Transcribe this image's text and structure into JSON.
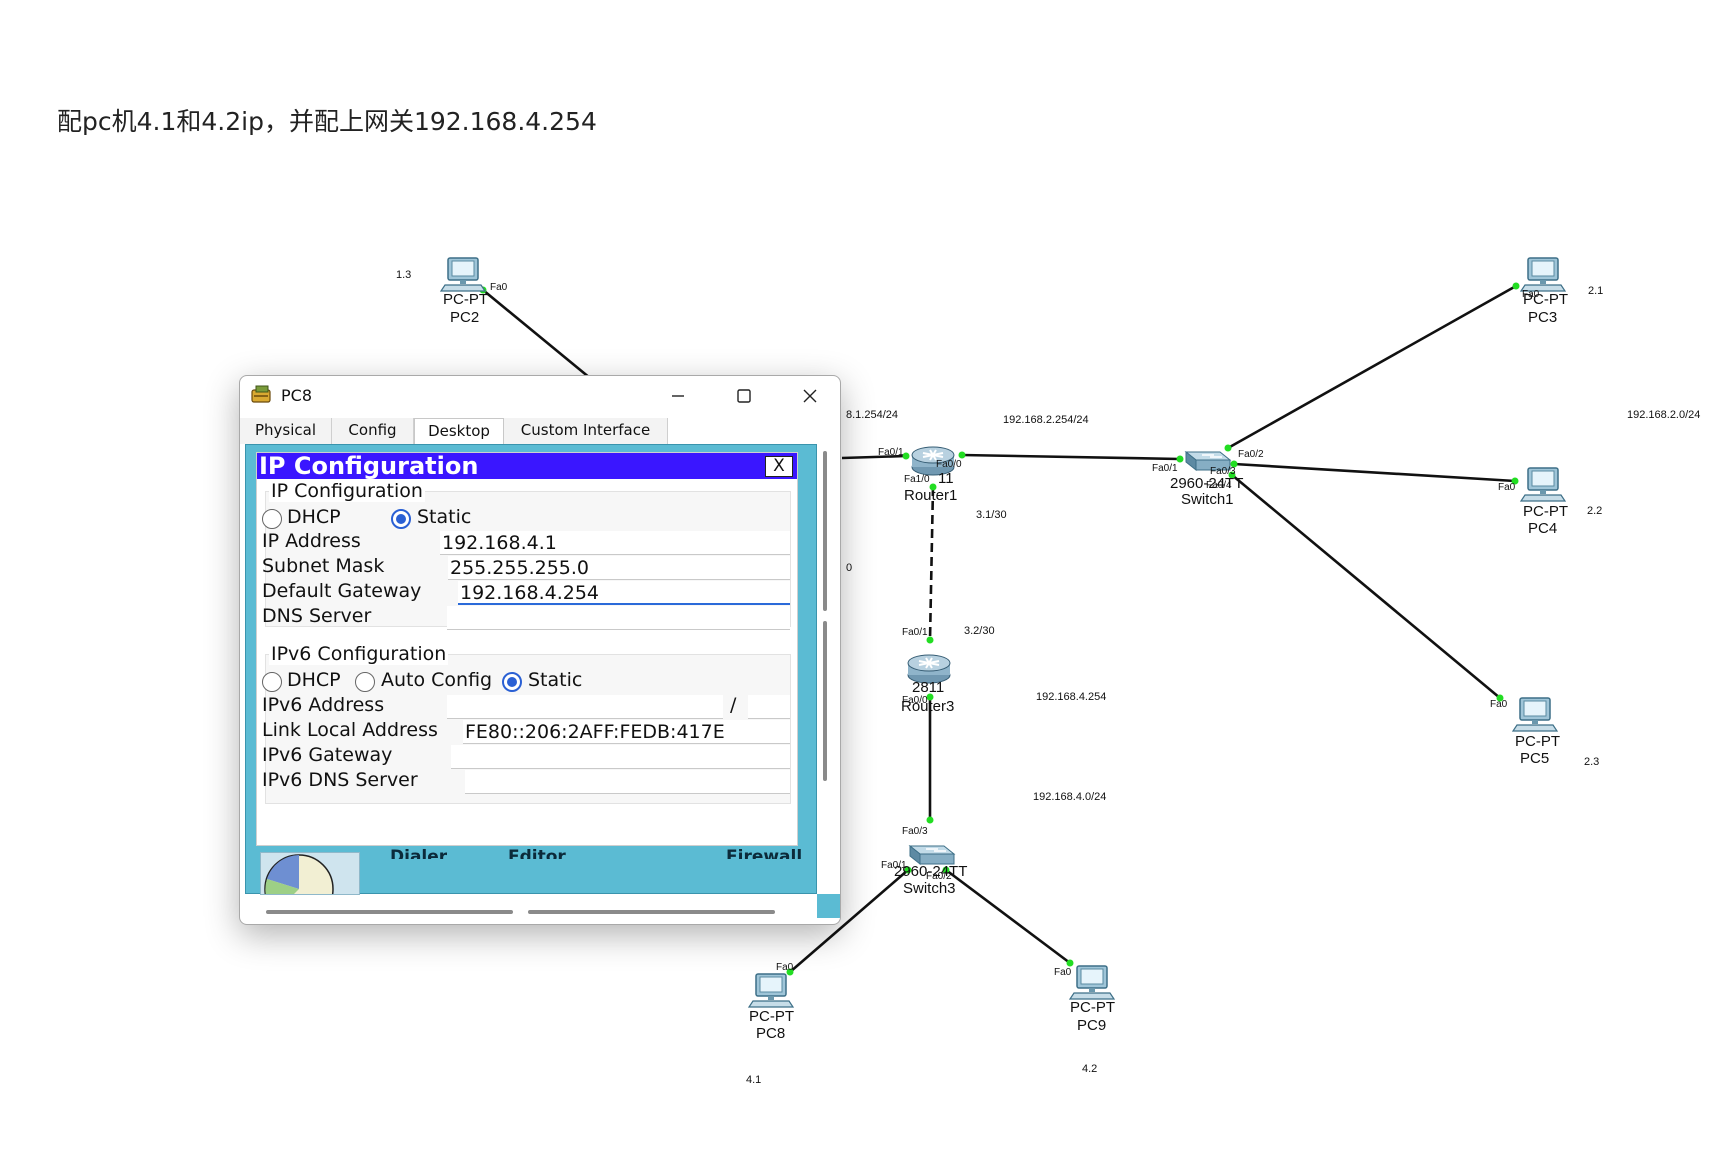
{
  "heading": "配pc机4.1和4.2ip，并配上网关192.168.4.254",
  "topology": {
    "devices": {
      "pc2": {
        "type": "PC-PT",
        "name": "PC2",
        "port": "Fa0",
        "note": "1.3"
      },
      "pc3": {
        "type": "PC-PT",
        "name": "PC3",
        "port": "Fa0",
        "note": "2.1"
      },
      "pc4": {
        "type": "PC-PT",
        "name": "PC4",
        "port": "Fa0",
        "note": "2.2"
      },
      "pc5": {
        "type": "PC-PT",
        "name": "PC5",
        "port": "Fa0",
        "note": "2.3"
      },
      "pc8": {
        "type": "PC-PT",
        "name": "PC8",
        "port": "Fa0",
        "note": "4.1"
      },
      "pc9": {
        "type": "PC-PT",
        "name": "PC9",
        "port": "Fa0",
        "note": "4.2"
      },
      "router1": {
        "model": "11",
        "name": "Router1",
        "ports": [
          "Fa0/1",
          "Fa0/0",
          "Fa1/0"
        ]
      },
      "router3": {
        "model": "2811",
        "name": "Router3",
        "ports": [
          "Fa0/1",
          "Fa0/0"
        ]
      },
      "switch1": {
        "model": "2960-24TT",
        "name": "Switch1",
        "ports": [
          "Fa0/1",
          "Fa0/2",
          "Fa0/3",
          "Fa0/4"
        ]
      },
      "switch3": {
        "model": "2960-24TT",
        "name": "Switch3",
        "ports": [
          "Fa0/3",
          "Fa0/1",
          "Fa0/2"
        ]
      }
    },
    "labels": {
      "net1_gw": "8.1.254/24",
      "net2_gw": "192.168.2.254/24",
      "net2": "192.168.2.0/24",
      "link_r1": "3.1/30",
      "link_r3": "3.2/30",
      "net4_gw": "192.168.4.254",
      "net4": "192.168.4.0/24",
      "partial": "0"
    },
    "colors": {
      "link": "#111111",
      "port_dot": "#22dd22"
    }
  },
  "window": {
    "title": "PC8",
    "tabs": [
      "Physical",
      "Config",
      "Desktop",
      "Custom Interface"
    ],
    "active_tab": "Desktop",
    "behind_labels": [
      "Dialer",
      "Editor",
      "Firewall"
    ],
    "ip_config": {
      "title": "IP Configuration",
      "close_label": "X",
      "ipv4": {
        "group_label": "IP Configuration",
        "dhcp_label": "DHCP",
        "static_label": "Static",
        "mode": "Static",
        "ip_address_label": "IP Address",
        "ip_address": "192.168.4.1",
        "subnet_mask_label": "Subnet Mask",
        "subnet_mask": "255.255.255.0",
        "gateway_label": "Default Gateway",
        "gateway": "192.168.4.254",
        "dns_label": "DNS Server",
        "dns": ""
      },
      "ipv6": {
        "group_label": "IPv6 Configuration",
        "dhcp_label": "DHCP",
        "auto_label": "Auto Config",
        "static_label": "Static",
        "mode": "Static",
        "address_label": "IPv6 Address",
        "address": "",
        "prefix_sep": "/",
        "prefix": "",
        "link_local_label": "Link Local Address",
        "link_local": "FE80::206:2AFF:FEDB:417E",
        "gateway_label": "IPv6 Gateway",
        "gateway": "",
        "dns_label": "IPv6 DNS Server",
        "dns": ""
      }
    }
  }
}
